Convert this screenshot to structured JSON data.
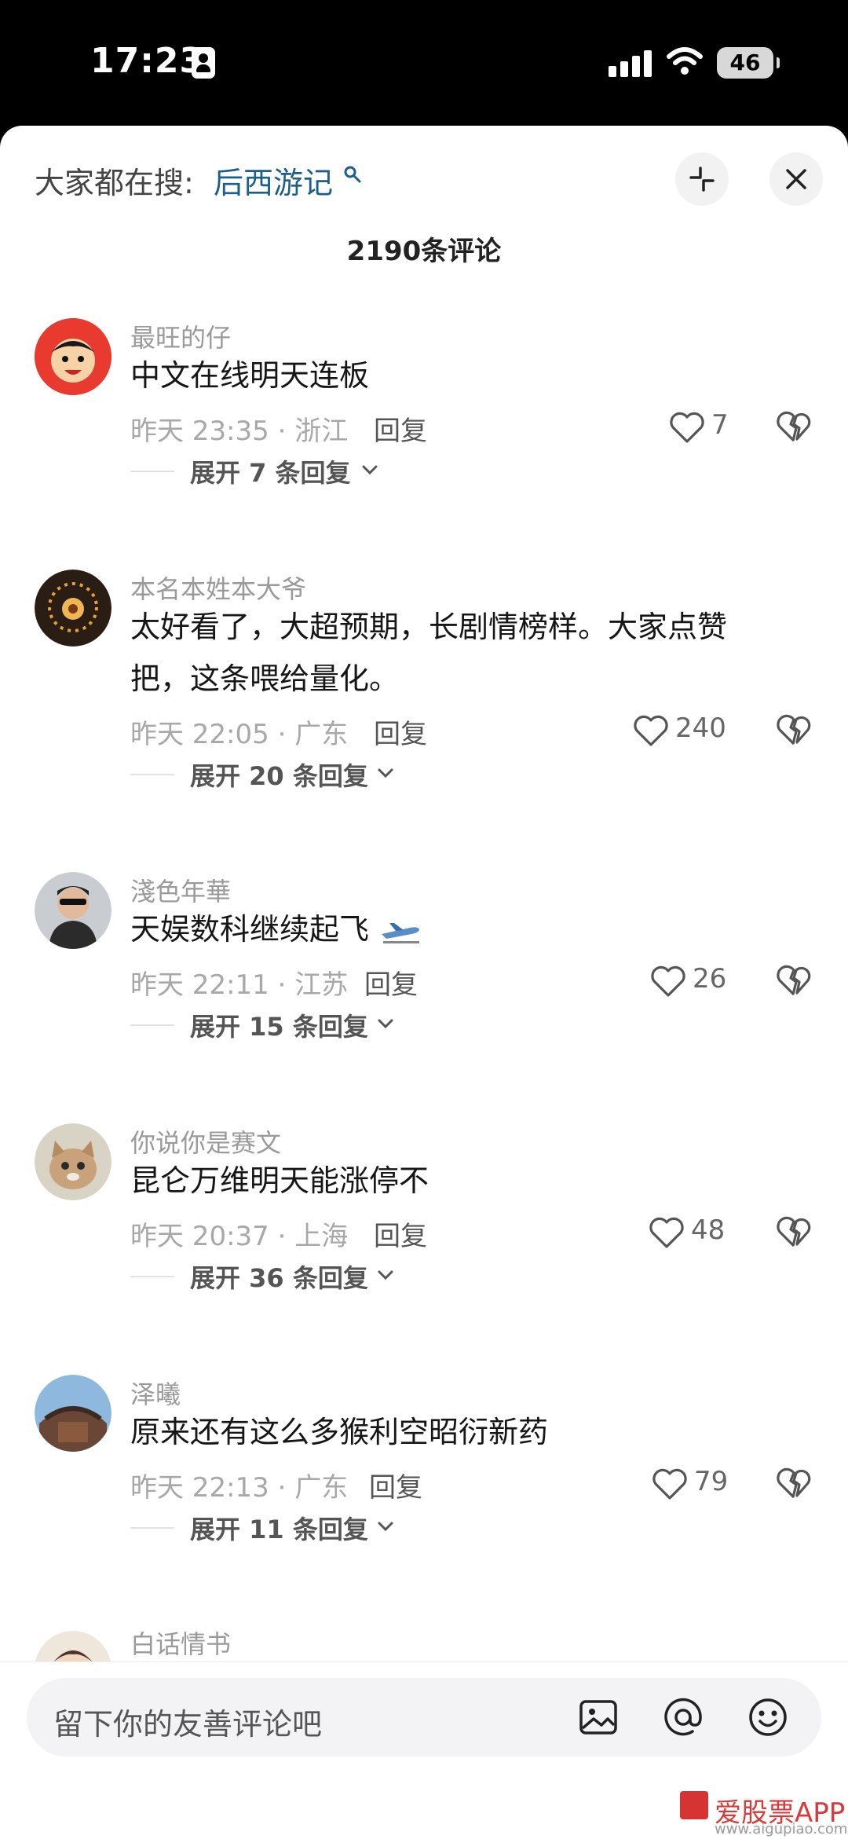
{
  "status_bar": {
    "time": "17:23",
    "battery": "46"
  },
  "header": {
    "trending_label": "大家都在搜:",
    "trending_term": "后西游记",
    "comment_count": "2190条评论"
  },
  "comments": [
    {
      "username": "最旺的仔",
      "text": "中文在线明天连板",
      "time": "昨天 23:35 · 浙江",
      "reply": "回复",
      "likes": "7",
      "expand": "展开 7 条回复"
    },
    {
      "username": "本名本姓本大爷",
      "text": "太好看了，大超预期，长剧情榜样。大家点赞把，这条喂给量化。",
      "time": "昨天 22:05 · 广东",
      "reply": "回复",
      "likes": "240",
      "expand": "展开 20 条回复"
    },
    {
      "username": "淺色年華",
      "text": "天娱数科继续起飞",
      "time": "昨天 22:11 · 江苏",
      "reply": "回复",
      "likes": "26",
      "expand": "展开 15 条回复"
    },
    {
      "username": "你说你是赛文",
      "text": "昆仑万维明天能涨停不",
      "time": "昨天 20:37 · 上海",
      "reply": "回复",
      "likes": "48",
      "expand": "展开 36 条回复"
    },
    {
      "username": "泽曦",
      "text": "原来还有这么多猴利空昭衍新药",
      "time": "昨天 22:13 · 广东",
      "reply": "回复",
      "likes": "79",
      "expand": "展开 11 条回复"
    },
    {
      "username": "白话情书"
    }
  ],
  "input": {
    "placeholder": "留下你的友善评论吧"
  },
  "watermark": {
    "text": "爱股票APP",
    "url": "www.aigupiao.com"
  },
  "colors": {
    "link": "#1e5f8a",
    "meta": "#a8a8a8",
    "watermark": "#d83a3a"
  }
}
